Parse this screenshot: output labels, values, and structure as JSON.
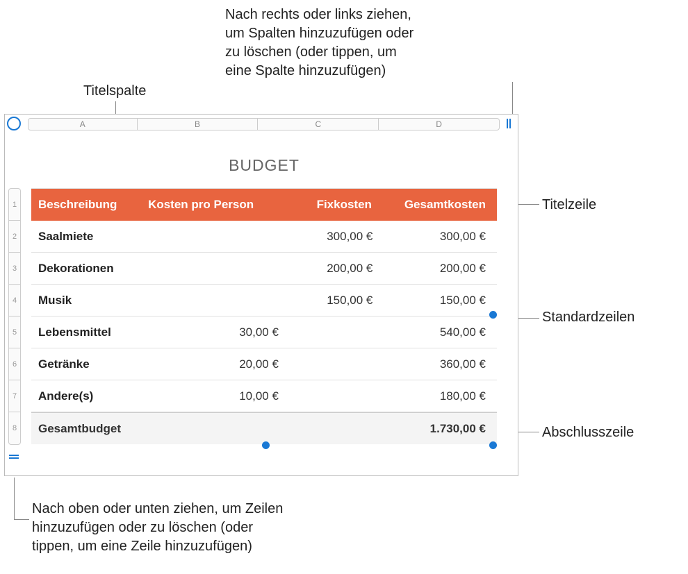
{
  "callouts": {
    "top_right": "Nach rechts oder links ziehen,\num Spalten hinzuzufügen oder\nzu löschen (oder tippen, um\neine Spalte hinzuzufügen)",
    "title_column": "Titelspalte",
    "title_row": "Titelzeile",
    "body_rows": "Standardzeilen",
    "footer_row": "Abschlusszeile",
    "bottom_left": "Nach oben oder unten ziehen, um Zeilen\nhinzuzufügen oder zu löschen (oder\ntippen, um eine Zeile hinzuzufügen)"
  },
  "table": {
    "title": "BUDGET",
    "column_letters": [
      "A",
      "B",
      "C",
      "D"
    ],
    "row_numbers": [
      "1",
      "2",
      "3",
      "4",
      "5",
      "6",
      "7",
      "8"
    ],
    "header": [
      "Beschreibung",
      "Kosten pro Person",
      "Fixkosten",
      "Gesamtkosten"
    ],
    "rows": [
      {
        "c0": "Saalmiete",
        "c1": "",
        "c2": "300,00 €",
        "c3": "300,00 €"
      },
      {
        "c0": "Dekorationen",
        "c1": "",
        "c2": "200,00 €",
        "c3": "200,00 €"
      },
      {
        "c0": "Musik",
        "c1": "",
        "c2": "150,00 €",
        "c3": "150,00 €"
      },
      {
        "c0": "Lebensmittel",
        "c1": "30,00 €",
        "c2": "",
        "c3": "540,00 €"
      },
      {
        "c0": "Getränke",
        "c1": "20,00 €",
        "c2": "",
        "c3": "360,00 €"
      },
      {
        "c0": "Andere(s)",
        "c1": "10,00 €",
        "c2": "",
        "c3": "180,00 €"
      }
    ],
    "footer": {
      "c0": "Gesamtbudget",
      "c1": "",
      "c2": "",
      "c3": "1.730,00 €"
    }
  }
}
